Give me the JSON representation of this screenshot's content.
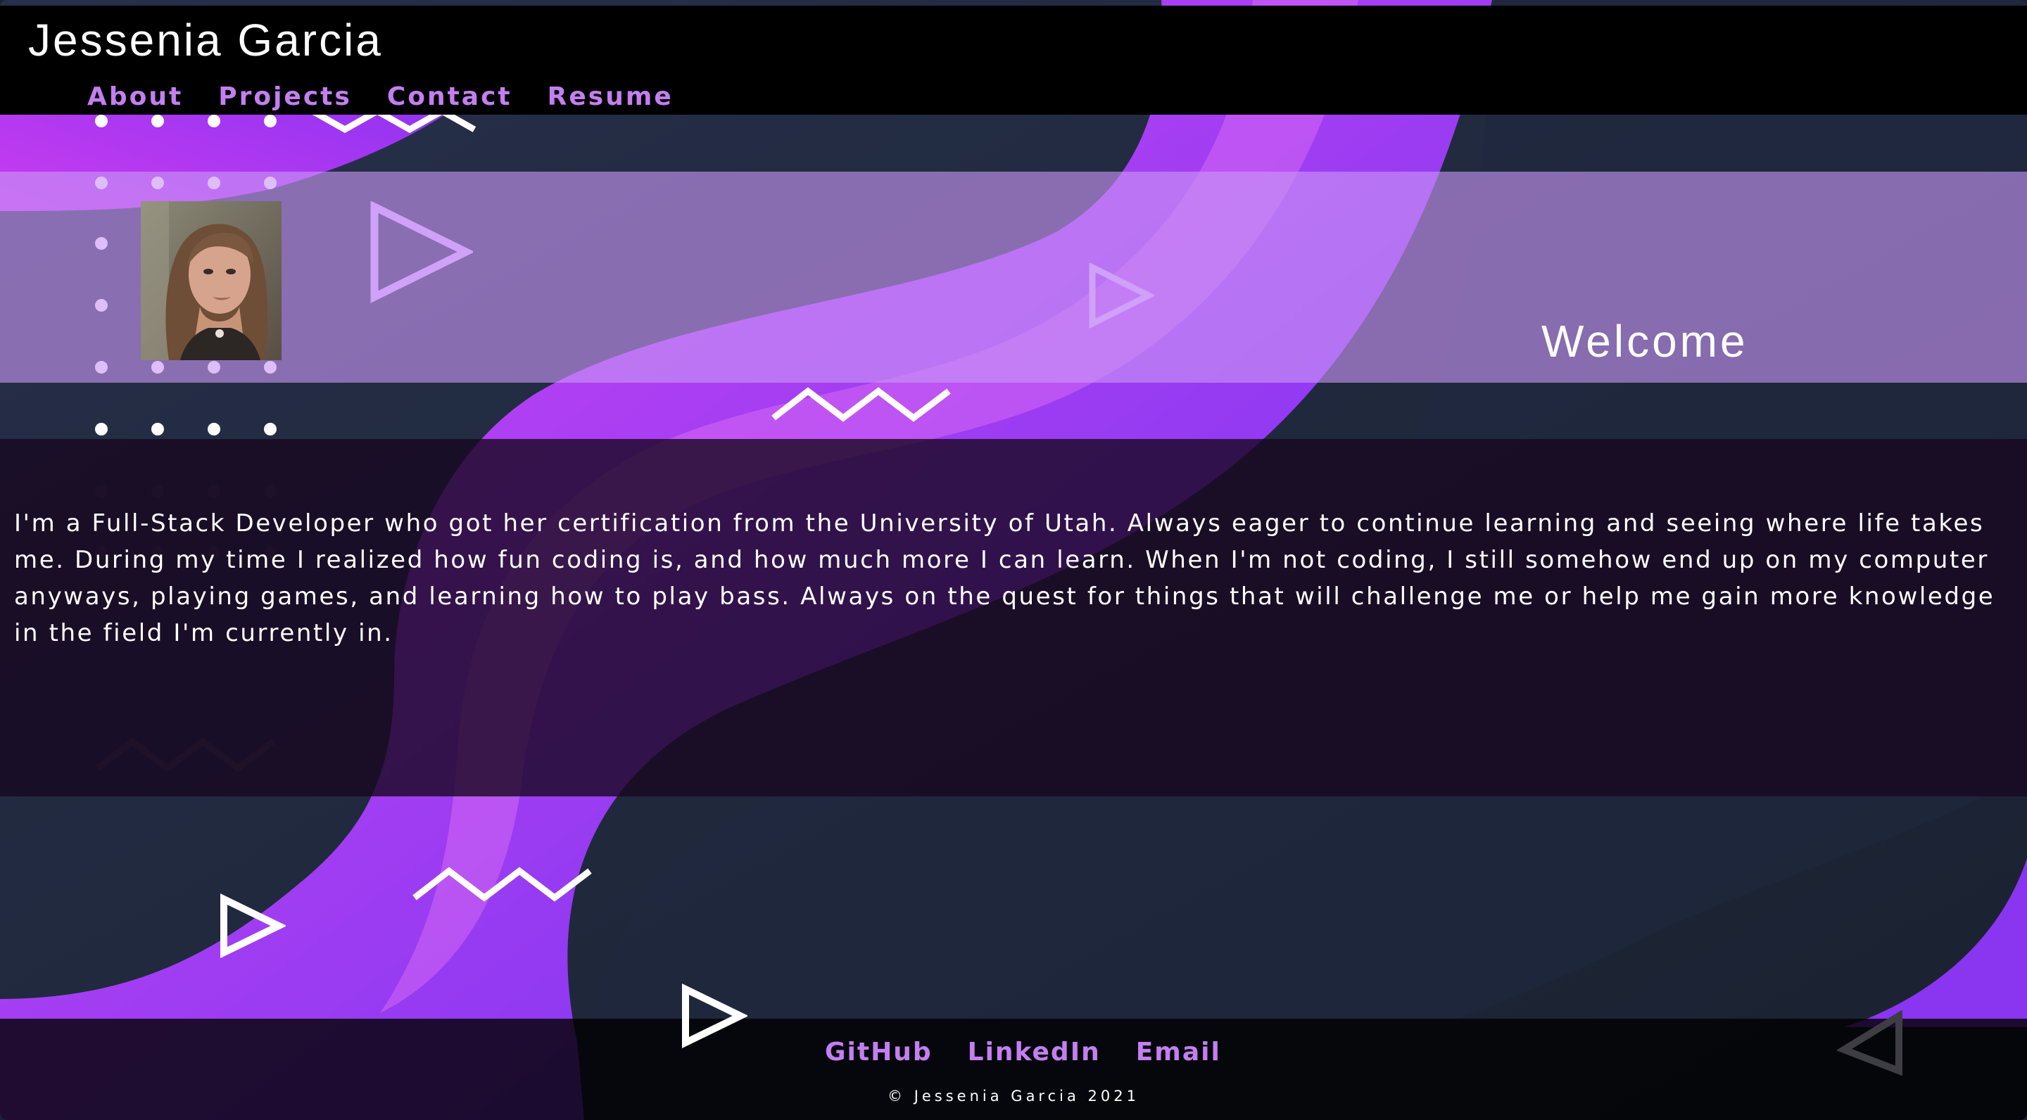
{
  "header": {
    "site_title": "Jessenia Garcia",
    "nav": [
      {
        "label": "About"
      },
      {
        "label": "Projects"
      },
      {
        "label": "Contact"
      },
      {
        "label": "Resume"
      }
    ]
  },
  "welcome": {
    "heading": "Welcome",
    "avatar_icon": "profile-photo"
  },
  "about": {
    "text": "I'm a Full-Stack Developer who got her certification from the University of Utah. Always eager to continue learning and seeing where life takes me. During my time I realized how fun coding is, and how much more I can learn. When I'm not coding, I still somehow end up on my computer anyways, playing games, and learning how to play bass. Always on the quest for things that will challenge me or help me gain more knowledge in the field I'm currently in."
  },
  "footer": {
    "links": [
      {
        "label": "GitHub"
      },
      {
        "label": "LinkedIn"
      },
      {
        "label": "Email"
      }
    ],
    "copyright": "© Jessenia Garcia 2021"
  },
  "colors": {
    "accent": "#c37ff0",
    "header_bg": "#000000",
    "welcome_band": "#c896f5",
    "about_band": "#180820",
    "background": "#1b2233",
    "purple_shape": "#b340f0"
  }
}
